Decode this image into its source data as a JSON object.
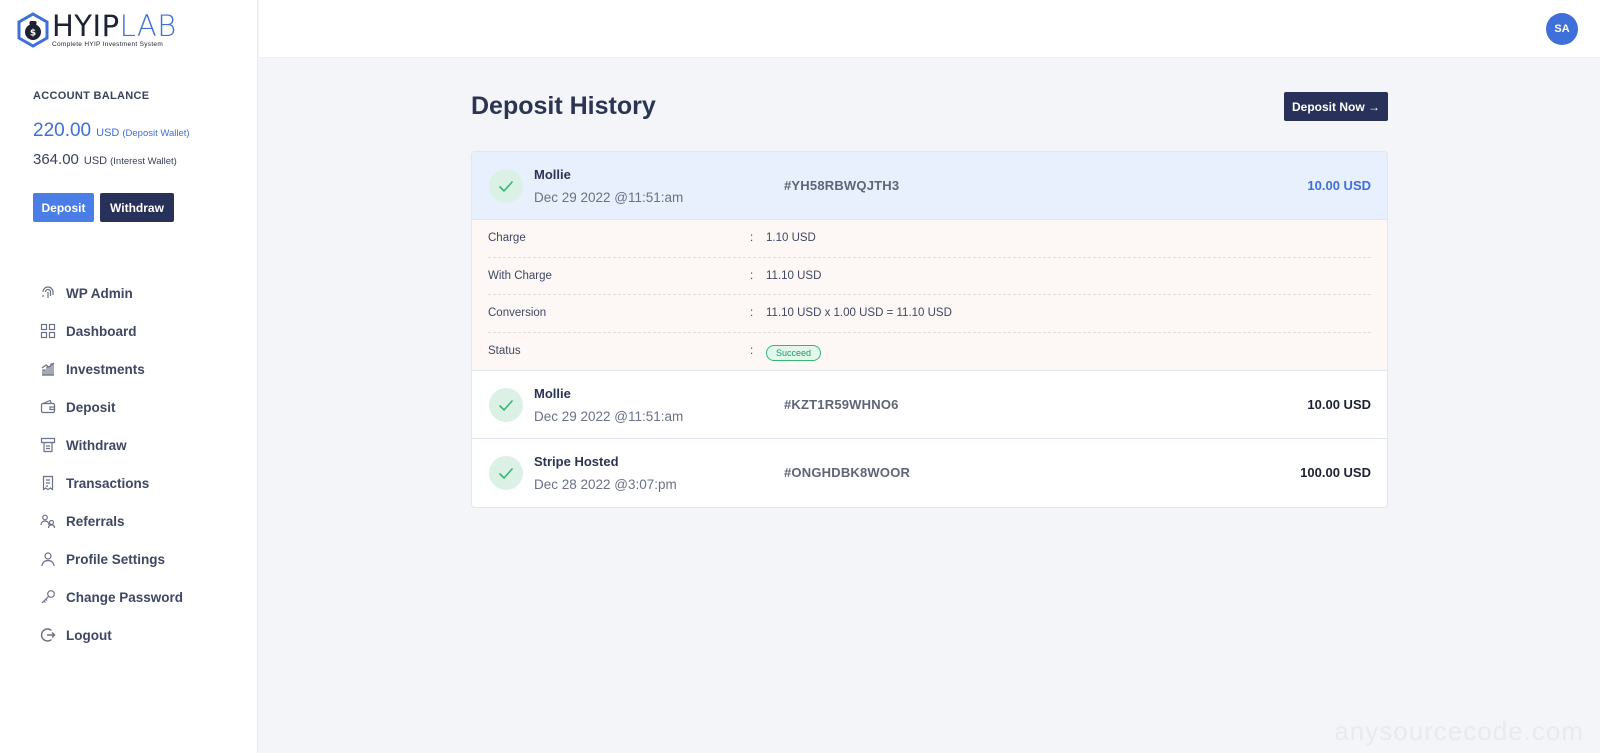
{
  "brand": {
    "name_part1": "HYIP",
    "name_part2": "LAB",
    "tagline": "Complete HYIP Investment System"
  },
  "sidebar": {
    "balance_label": "ACCOUNT BALANCE",
    "deposit_wallet": {
      "amount": "220.00",
      "currency": "USD",
      "label": "(Deposit Wallet)"
    },
    "interest_wallet": {
      "amount": "364.00",
      "currency": "USD",
      "label": "(Interest Wallet)"
    },
    "deposit_button": "Deposit",
    "withdraw_button": "Withdraw",
    "nav": [
      {
        "label": "WP Admin",
        "icon": "fingerprint-icon"
      },
      {
        "label": "Dashboard",
        "icon": "grid-icon"
      },
      {
        "label": "Investments",
        "icon": "chart-icon"
      },
      {
        "label": "Deposit",
        "icon": "wallet-icon"
      },
      {
        "label": "Withdraw",
        "icon": "atm-icon"
      },
      {
        "label": "Transactions",
        "icon": "receipt-icon"
      },
      {
        "label": "Referrals",
        "icon": "users-icon"
      },
      {
        "label": "Profile Settings",
        "icon": "user-icon"
      },
      {
        "label": "Change Password",
        "icon": "key-icon"
      },
      {
        "label": "Logout",
        "icon": "logout-icon"
      }
    ]
  },
  "topbar": {
    "avatar_initials": "SA"
  },
  "main": {
    "title": "Deposit History",
    "deposit_now_button": "Deposit Now →",
    "rows": [
      {
        "method": "Mollie",
        "date": "Dec 29 2022 @11:51:am",
        "trx": "#YH58RBWQJTH3",
        "amount": "10.00 USD"
      },
      {
        "method": "Mollie",
        "date": "Dec 29 2022 @11:51:am",
        "trx": "#KZT1R59WHNO6",
        "amount": "10.00 USD"
      },
      {
        "method": "Stripe Hosted",
        "date": "Dec 28 2022 @3:07:pm",
        "trx": "#ONGHDBK8WOOR",
        "amount": "100.00 USD"
      }
    ],
    "details": {
      "charge_label": "Charge",
      "charge_value": "1.10 USD",
      "with_charge_label": "With Charge",
      "with_charge_value": "11.10 USD",
      "conversion_label": "Conversion",
      "conversion_value": "11.10 USD x 1.00 USD = 11.10 USD",
      "status_label": "Status",
      "status_value": "Succeed",
      "separator": ":"
    }
  },
  "watermark": "anysourcecode.com",
  "colors": {
    "primary": "#3f6fd8",
    "dark": "#27315a",
    "success": "#35b876"
  }
}
